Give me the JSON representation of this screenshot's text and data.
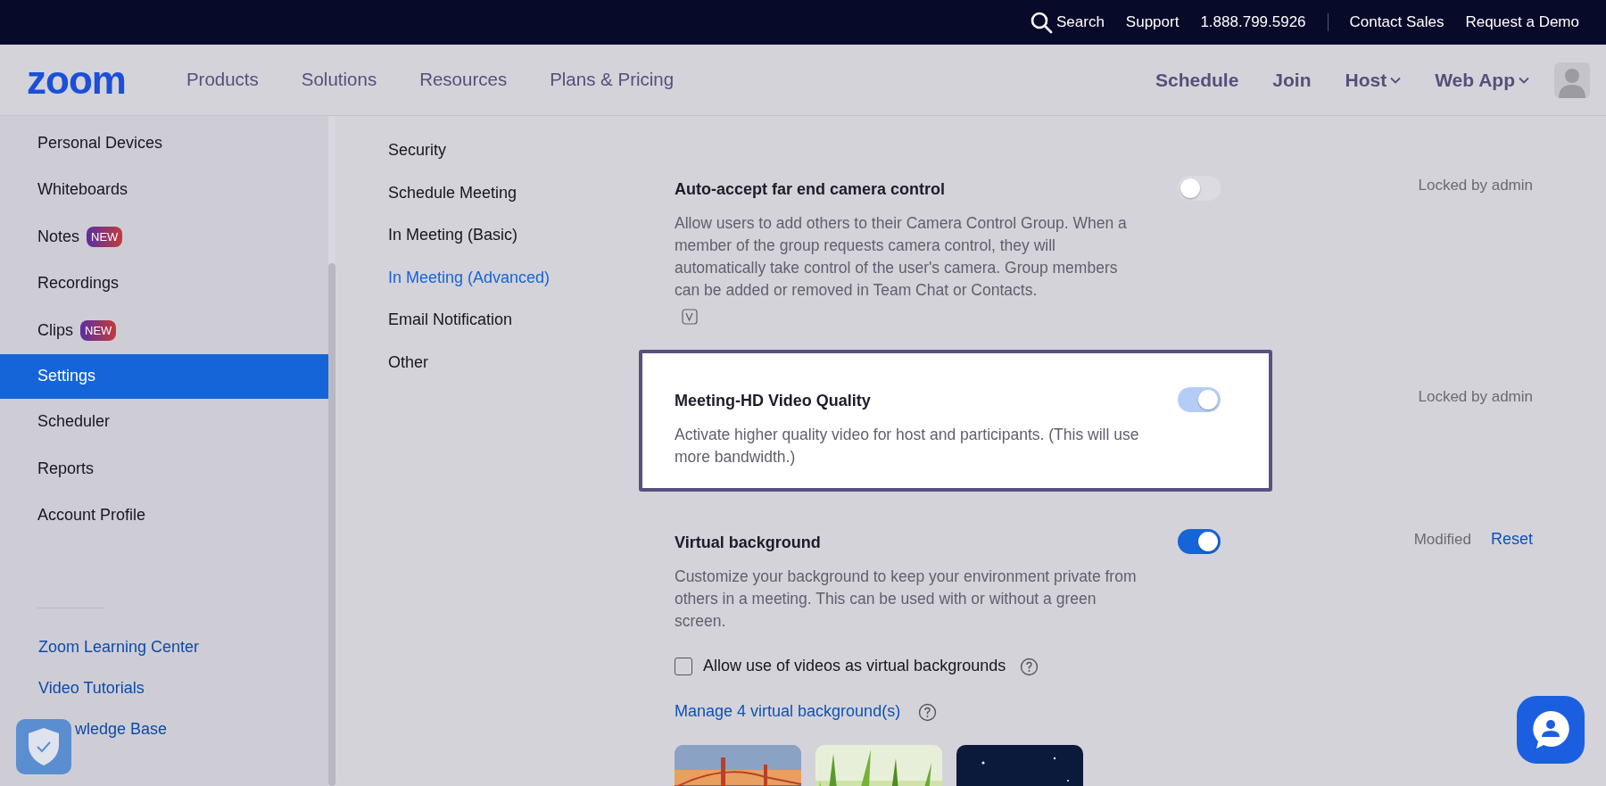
{
  "top_bar": {
    "search": "Search",
    "links": [
      "Support",
      "1.888.799.5926"
    ],
    "links_after_divider": [
      "Contact Sales",
      "Request a Demo"
    ]
  },
  "navbar": {
    "logo": "zoom",
    "items": [
      "Products",
      "Solutions",
      "Resources",
      "Plans & Pricing"
    ],
    "right_items": [
      {
        "label": "Schedule",
        "dropdown": false
      },
      {
        "label": "Join",
        "dropdown": false
      },
      {
        "label": "Host",
        "dropdown": true
      },
      {
        "label": "Web App",
        "dropdown": true
      }
    ]
  },
  "sidebar": {
    "items": [
      {
        "label": "Personal Devices",
        "selected": false
      },
      {
        "label": "Whiteboards",
        "selected": false
      },
      {
        "label": "Notes",
        "badge": "NEW",
        "selected": false
      },
      {
        "label": "Recordings",
        "selected": false
      },
      {
        "label": "Clips",
        "badge": "NEW",
        "selected": false
      },
      {
        "label": "Settings",
        "selected": true
      },
      {
        "label": "Scheduler",
        "selected": false
      },
      {
        "label": "Reports",
        "selected": false
      },
      {
        "label": "Account Profile",
        "selected": false
      }
    ],
    "links": [
      "Zoom Learning Center",
      "Video Tutorials",
      "wledge Base"
    ]
  },
  "settings_nav": [
    {
      "label": "Security",
      "selected": false
    },
    {
      "label": "Schedule Meeting",
      "selected": false
    },
    {
      "label": "In Meeting (Basic)",
      "selected": false
    },
    {
      "label": "In Meeting (Advanced)",
      "selected": true
    },
    {
      "label": "Email Notification",
      "selected": false
    },
    {
      "label": "Other",
      "selected": false
    }
  ],
  "settings": [
    {
      "title": "Auto-accept far end camera control",
      "description": "Allow users to add others to their Camera Control Group. When a member of the group requests camera control, they will automatically take control of the user's camera. Group members can be added or removed in Team Chat or Contacts.",
      "on": false,
      "disabled": true,
      "highlighted": false,
      "status": "Locked by admin"
    },
    {
      "title": "Meeting-HD Video Quality",
      "description": "Activate higher quality video for host and participants. (This will use more bandwidth.)",
      "on": true,
      "disabled": true,
      "highlighted": true,
      "status": "Locked by admin"
    },
    {
      "title": "Virtual background",
      "description": "Customize your background to keep your environment private from others in a meeting. This can be used with or without a green screen.",
      "on": true,
      "disabled": false,
      "highlighted": false,
      "status": "Modified",
      "action": "Reset",
      "checkbox": {
        "label": "Allow use of videos as virtual backgrounds",
        "checked": false
      },
      "manage_link": "Manage 4 virtual background(s)"
    }
  ]
}
